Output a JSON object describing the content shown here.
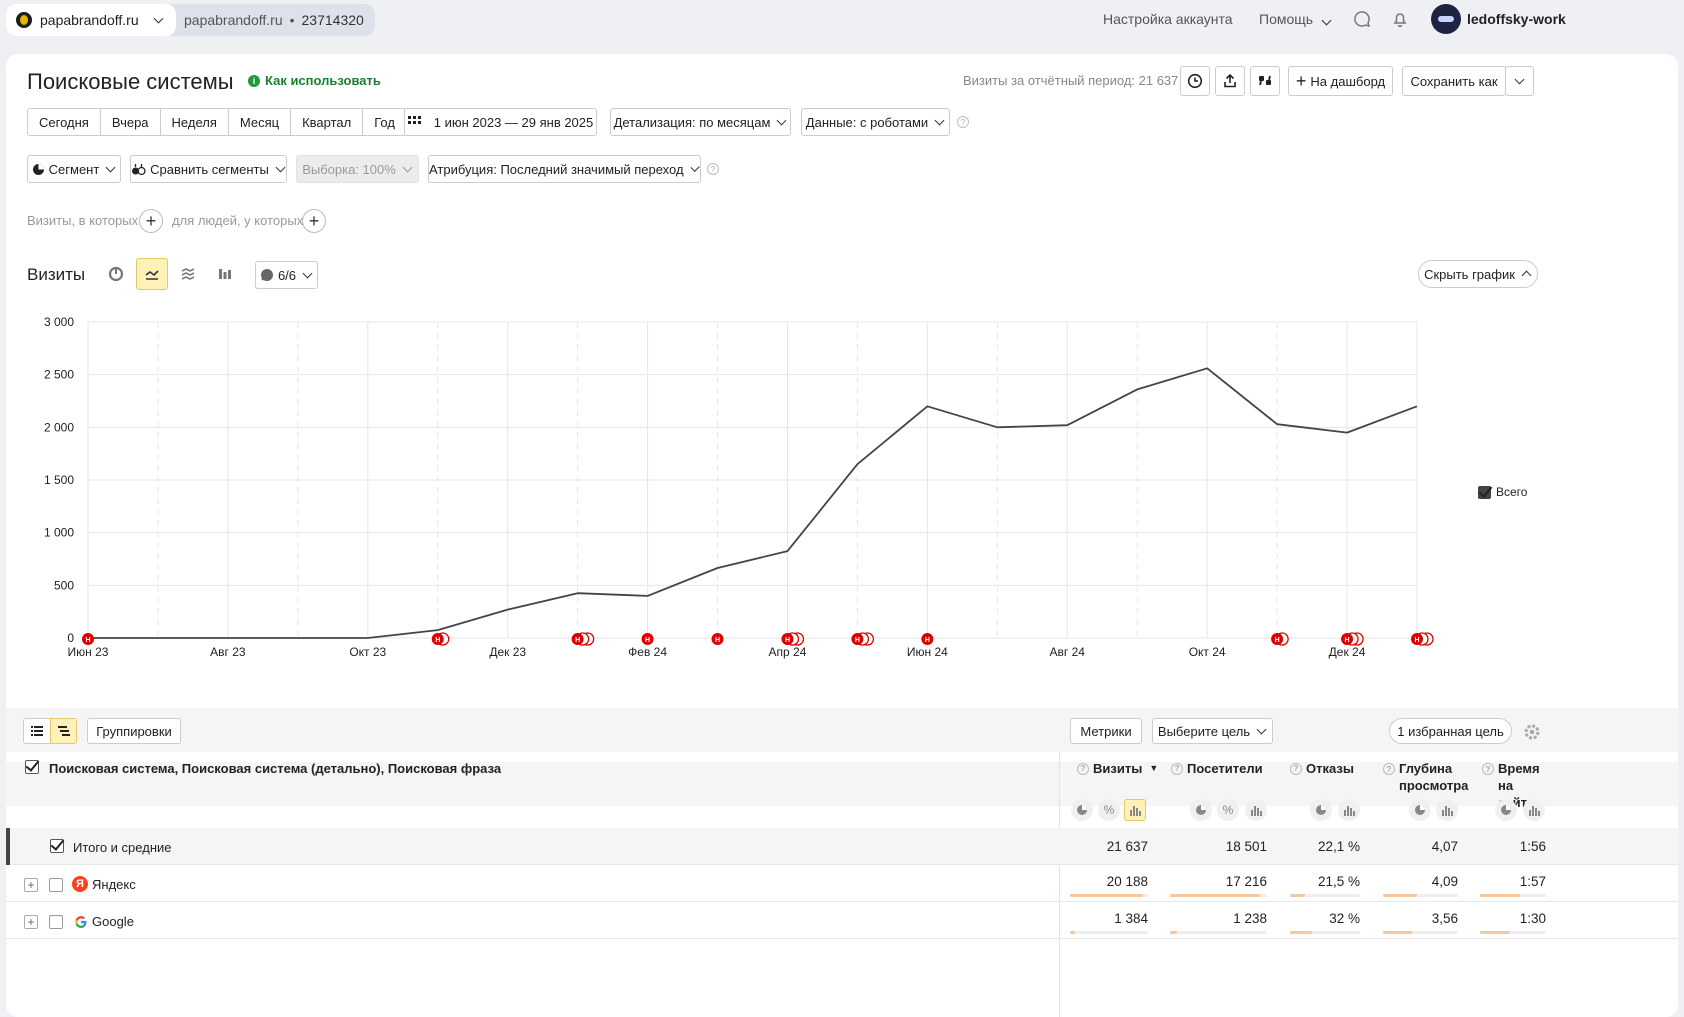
{
  "topbar": {
    "site": "papabrandoff.ru",
    "counter_site": "papabrandoff.ru",
    "counter_sep": "•",
    "counter_id": "23714320",
    "account_settings": "Настройка аккаунта",
    "help": "Помощь",
    "username": "ledoffsky-work"
  },
  "header": {
    "title": "Поисковые системы",
    "how_to_use": "Как использовать",
    "visits_summary": "Визиты за отчётный период: 21 637",
    "to_dashboard": "На дашборд",
    "save_as": "Сохранить как"
  },
  "periods": [
    "Сегодня",
    "Вчера",
    "Неделя",
    "Месяц",
    "Квартал",
    "Год"
  ],
  "filters": {
    "date_range": "1 июн 2023 — 29 янв 2025",
    "detail": "Детализация: по месяцам",
    "data": "Данные: с роботами",
    "segment": "Сегмент",
    "compare": "Сравнить сегменты",
    "sample": "Выборка: 100%",
    "attribution": "Атрибуция: Последний значимый переход",
    "visits_where": "Визиты, в которых",
    "people_where": "для людей, у которых"
  },
  "chart_panel": {
    "title": "Визиты",
    "notes_count": "6/6",
    "hide_chart": "Скрыть график",
    "legend_total": "Всего"
  },
  "chart_data": {
    "type": "line",
    "title": "",
    "xlabel": "",
    "ylabel": "",
    "x": [
      "Июн 23",
      "Июл 23",
      "Авг 23",
      "Сен 23",
      "Окт 23",
      "Ноя 23",
      "Дек 23",
      "Янв 24",
      "Фев 24",
      "Мар 24",
      "Апр 24",
      "Май 24",
      "Июн 24",
      "Июл 24",
      "Авг 24",
      "Сен 24",
      "Окт 24",
      "Ноя 24",
      "Дек 24",
      "Янв 25"
    ],
    "x_tick_labels": [
      "Июн 23",
      "Авг 23",
      "Окт 23",
      "Дек 23",
      "Фев 24",
      "Апр 24",
      "Июн 24",
      "Авг 24",
      "Окт 24",
      "Дек 24"
    ],
    "y_tick_labels": [
      "0",
      "500",
      "1 000",
      "1 500",
      "2 000",
      "2 500",
      "3 000"
    ],
    "ylim": [
      0,
      3000
    ],
    "grid": true,
    "legend": "right",
    "series": [
      {
        "name": "Всего",
        "color": "#444444",
        "values": [
          0,
          0,
          0,
          0,
          0,
          75,
          270,
          425,
          400,
          665,
          825,
          1650,
          2200,
          2000,
          2020,
          2360,
          2560,
          2030,
          1950,
          2200
        ]
      }
    ],
    "notes": [
      {
        "x": "Июн 23",
        "count": 1
      },
      {
        "x": "Ноя 23",
        "count": 2
      },
      {
        "x": "Янв 24",
        "count": 3
      },
      {
        "x": "Фев 24",
        "count": 1
      },
      {
        "x": "Мар 24",
        "count": 1
      },
      {
        "x": "Апр 24",
        "count": 3
      },
      {
        "x": "Май 24",
        "count": 3
      },
      {
        "x": "Июн 24",
        "count": 1
      },
      {
        "x": "Ноя 24",
        "count": 2
      },
      {
        "x": "Дек 24",
        "count": 3
      },
      {
        "x": "Янв 25",
        "count": 3
      }
    ],
    "note_letter": "Н"
  },
  "table_toolbar": {
    "groupings": "Группировки",
    "metrics": "Метрики",
    "goal": "Выберите цель",
    "fav_goal": "1 избранная цель"
  },
  "table": {
    "dimension_header": "Поисковая система, Поисковая система (детально), Поисковая фраза",
    "columns": [
      {
        "label": "Визиты",
        "sort": "▼"
      },
      {
        "label": "Посетители"
      },
      {
        "label": "Отказы"
      },
      {
        "label": "Глубина просмотра"
      },
      {
        "label": "Время на сайте"
      }
    ],
    "totals": {
      "label": "Итого и средние",
      "values": [
        "21 637",
        "18 501",
        "22,1 %",
        "4,07",
        "1:56"
      ]
    },
    "rows": [
      {
        "label": "Яндекс",
        "values": [
          "20 188",
          "17 216",
          "21,5 %",
          "4,09",
          "1:57"
        ],
        "share": [
          0.93,
          0.93,
          0.22,
          0.45,
          0.6
        ]
      },
      {
        "label": "Google",
        "values": [
          "1 384",
          "1 238",
          "32 %",
          "3,56",
          "1:30"
        ],
        "share": [
          0.07,
          0.07,
          0.32,
          0.39,
          0.45
        ]
      }
    ]
  }
}
